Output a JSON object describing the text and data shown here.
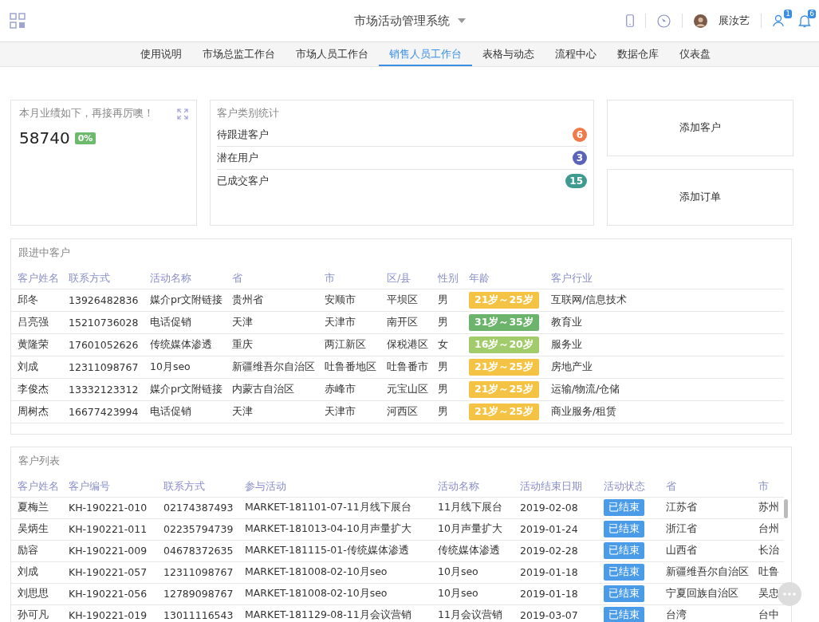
{
  "header": {
    "title": "市场活动管理系统",
    "user_name": "展汝艺",
    "group_badge": "1",
    "bell_badge": "6"
  },
  "tabs": [
    {
      "label": "使用说明",
      "selected": false
    },
    {
      "label": "市场总监工作台",
      "selected": false
    },
    {
      "label": "市场人员工作台",
      "selected": false
    },
    {
      "label": "销售人员工作台",
      "selected": true
    },
    {
      "label": "表格与动态",
      "selected": false
    },
    {
      "label": "流程中心",
      "selected": false
    },
    {
      "label": "数据仓库",
      "selected": false
    },
    {
      "label": "仪表盘",
      "selected": false
    }
  ],
  "performance": {
    "title": "本月业绩如下，再接再厉噢！",
    "value": "58740",
    "percent": "0%"
  },
  "category_stats": {
    "title": "客户类别统计",
    "items": [
      {
        "label": "待跟进客户",
        "count": "6",
        "color": "#ef7a4a"
      },
      {
        "label": "潜在用户",
        "count": "3",
        "color": "#5b63b8"
      },
      {
        "label": "已成交客户",
        "count": "15",
        "color": "#3f9b8f"
      }
    ]
  },
  "actions": [
    "添加客户",
    "添加订单"
  ],
  "following": {
    "title": "跟进中客户",
    "columns": [
      "客户姓名",
      "联系方式",
      "活动名称",
      "省",
      "市",
      "区/县",
      "性别",
      "年龄",
      "客户行业"
    ],
    "rows": [
      {
        "cells": [
          "邱冬",
          "13926482836",
          "媒介pr文附链接",
          "贵州省",
          "安顺市",
          "平坝区",
          "男"
        ],
        "age": "21岁～25岁",
        "color": "#f5c343",
        "industry": "互联网/信息技术"
      },
      {
        "cells": [
          "吕亮强",
          "15210736028",
          "电话促销",
          "天津",
          "天津市",
          "南开区",
          "男"
        ],
        "age": "31岁～35岁",
        "color": "#6cb36c",
        "industry": "教育业"
      },
      {
        "cells": [
          "黄隆荣",
          "17601052626",
          "传统媒体渗透",
          "重庆",
          "两江新区",
          "保税港区",
          "女"
        ],
        "age": "16岁～20岁",
        "color": "#a2cb6b",
        "industry": "服务业"
      },
      {
        "cells": [
          "刘成",
          "12311098767",
          "10月seo",
          "新疆维吾尔自治区",
          "吐鲁番地区",
          "吐鲁番市",
          "男"
        ],
        "age": "21岁～25岁",
        "color": "#f5c343",
        "industry": "房地产业"
      },
      {
        "cells": [
          "李俊杰",
          "13332123312",
          "媒介pr文附链接",
          "内蒙古自治区",
          "赤峰市",
          "元宝山区",
          "男"
        ],
        "age": "21岁～25岁",
        "color": "#f5c343",
        "industry": "运输/物流/仓储"
      },
      {
        "cells": [
          "周树杰",
          "16677423994",
          "电话促销",
          "天津",
          "天津市",
          "河西区",
          "男"
        ],
        "age": "21岁～25岁",
        "color": "#f5c343",
        "industry": "商业服务/租赁"
      }
    ]
  },
  "customers": {
    "title": "客户列表",
    "columns": [
      "客户姓名",
      "客户编号",
      "联系方式",
      "参与活动",
      "活动名称",
      "活动结束日期",
      "活动状态",
      "省",
      "市"
    ],
    "rows": [
      {
        "cells": [
          "夏梅兰",
          "KH-190221-010",
          "02174387493",
          "MARKET-181101-07-11月线下展台",
          "11月线下展台",
          "2019-02-08"
        ],
        "status": "已结束",
        "province": "江苏省",
        "city": "苏州"
      },
      {
        "cells": [
          "吴炳生",
          "KH-190221-011",
          "02235794739",
          "MARKET-181013-04-10月声量扩大",
          "10月声量扩大",
          "2019-01-24"
        ],
        "status": "已结束",
        "province": "浙江省",
        "city": "台州"
      },
      {
        "cells": [
          "励容",
          "KH-190221-009",
          "04678372635",
          "MARKET-181115-01-传统媒体渗透",
          "传统媒体渗透",
          "2019-02-28"
        ],
        "status": "已结束",
        "province": "山西省",
        "city": "长治"
      },
      {
        "cells": [
          "刘成",
          "KH-190221-057",
          "12311098767",
          "MARKET-181008-02-10月seo",
          "10月seo",
          "2019-01-18"
        ],
        "status": "已结束",
        "province": "新疆维吾尔自治区",
        "city": "吐鲁"
      },
      {
        "cells": [
          "刘思思",
          "KH-190221-056",
          "12789098767",
          "MARKET-181008-02-10月seo",
          "10月seo",
          "2019-01-18"
        ],
        "status": "已结束",
        "province": "宁夏回族自治区",
        "city": "吴忠"
      },
      {
        "cells": [
          "孙可凡",
          "KH-190221-019",
          "13011116543",
          "MARKET-181129-08-11月会议营销",
          "11月会议营销",
          "2019-03-07"
        ],
        "status": "已结束",
        "province": "台湾",
        "city": "台中"
      }
    ]
  }
}
